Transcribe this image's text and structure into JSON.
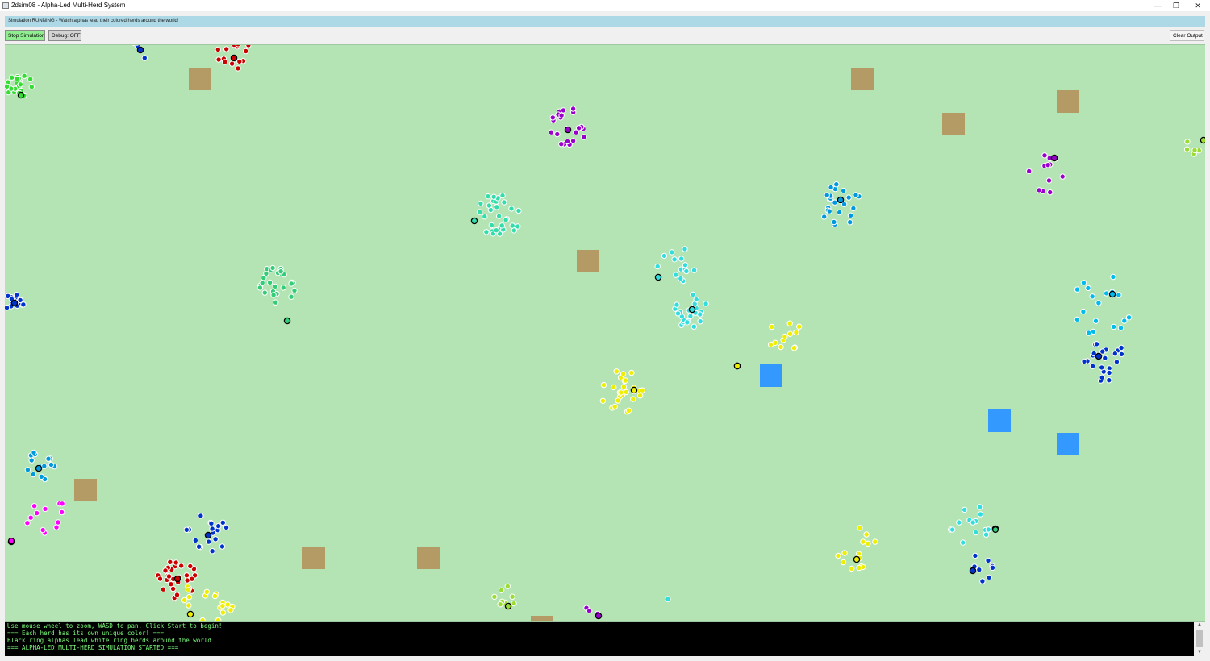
{
  "window": {
    "title": "2dsim08 - Alpha-Led Multi-Herd System",
    "controls": {
      "minimize": "—",
      "restore": "❐",
      "close": "✕"
    }
  },
  "status": {
    "text": "Simulation RUNNING - Watch alphas lead their colored herds around the world!",
    "background": "#add8e6"
  },
  "toolbar": {
    "stop_label": "Stop Simulation",
    "debug_label": "Debug: OFF",
    "clear_label": "Clear Output"
  },
  "colors": {
    "grass": "#b4e4b4",
    "dirt_patch": "#b49a64",
    "water_patch": "#3399ff",
    "stop_button": "#90ee90",
    "console_bg": "#000000",
    "console_text": "#7cfc7c"
  },
  "world": {
    "herds": [
      {
        "color": "#ff00ff"
      },
      {
        "color": "#0033cc"
      },
      {
        "color": "#cc0000"
      },
      {
        "color": "#33dd33"
      },
      {
        "color": "#9900cc"
      },
      {
        "color": "#33ddaa"
      },
      {
        "color": "#0099dd"
      },
      {
        "color": "#33cc77"
      },
      {
        "color": "#33dddd"
      },
      {
        "color": "#eeee00"
      },
      {
        "color": "#99dd33"
      },
      {
        "color": "#00bbee"
      }
    ]
  },
  "console": {
    "lines": [
      "Use mouse wheel to zoom, WASD to pan. Click Start to begin!",
      "=== Each herd has its own unique color! ===",
      "Black ring alphas lead white ring herds around the world",
      "=== ALPHA-LED MULTI-HERD SIMULATION STARTED ==="
    ]
  },
  "scrollbar": {
    "up_icon": "▲",
    "down_icon": "▼"
  }
}
